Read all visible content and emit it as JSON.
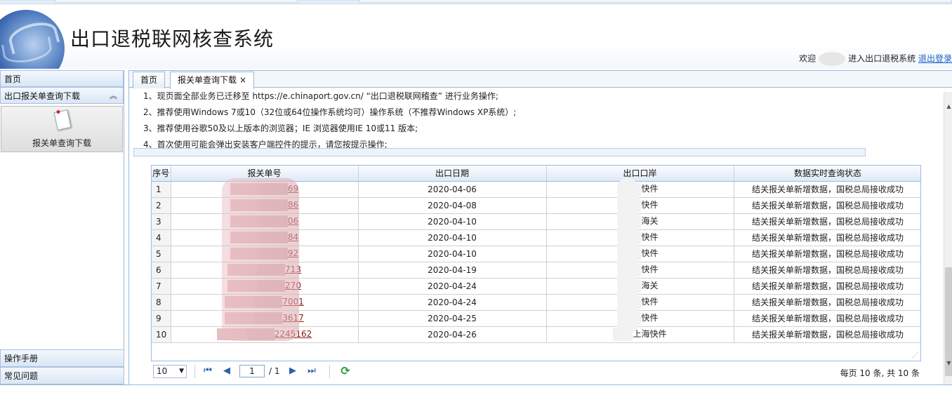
{
  "app": {
    "title": "出口退税联网核查系统",
    "welcome_prefix": "欢迎",
    "welcome_suffix": "进入出口退税系统",
    "logout": "退出登录"
  },
  "sidebar": {
    "sections": [
      {
        "label": "首页"
      },
      {
        "label": "出口报关单查询下载",
        "collapse_icon": "double-chevron-up-icon"
      }
    ],
    "item": {
      "label": "报关单查询下载",
      "icon": "document-icon"
    },
    "bottom_sections": [
      {
        "label": "操作手册"
      },
      {
        "label": "常见问题"
      }
    ]
  },
  "tabs": [
    {
      "label": "首页",
      "active": false
    },
    {
      "label": "报关单查询下载",
      "active": true,
      "close": "×"
    }
  ],
  "notices": [
    "1、现页面全部业务已迁移至 https://e.chinaport.gov.cn/ “出口退税联网稽查” 进行业务操作;",
    "2、推荐使用Windows 7或10（32位或64位操作系统均可）操作系统（不推荐Windows XP系统）;",
    "3、推荐使用谷歌50及以上版本的浏览器；IE 浏览器使用IE 10或11 版本;",
    "4、首次使用可能会弹出安装客户端控件的提示，请您按提示操作;"
  ],
  "grid": {
    "columns": [
      "序号",
      "报关单号",
      "出口日期",
      "出口口岸",
      "数据实时查询状态"
    ],
    "rows": [
      {
        "no": "1",
        "id_tail": "69",
        "date": "2020-04-06",
        "port": "快件",
        "status": "结关报关单新增数据，国税总局接收成功"
      },
      {
        "no": "2",
        "id_tail": "86",
        "date": "2020-04-08",
        "port": "快件",
        "status": "结关报关单新增数据，国税总局接收成功"
      },
      {
        "no": "3",
        "id_tail": "06",
        "date": "2020-04-10",
        "port": "海关",
        "status": "结关报关单新增数据，国税总局接收成功"
      },
      {
        "no": "4",
        "id_tail": "84",
        "date": "2020-04-10",
        "port": "快件",
        "status": "结关报关单新增数据，国税总局接收成功"
      },
      {
        "no": "5",
        "id_tail": "92",
        "date": "2020-04-10",
        "port": "快件",
        "status": "结关报关单新增数据，国税总局接收成功"
      },
      {
        "no": "6",
        "id_tail": "713",
        "date": "2020-04-19",
        "port": "快件",
        "status": "结关报关单新增数据，国税总局接收成功"
      },
      {
        "no": "7",
        "id_tail": "270",
        "date": "2020-04-24",
        "port": "海关",
        "status": "结关报关单新增数据，国税总局接收成功"
      },
      {
        "no": "8",
        "id_tail": "7001",
        "date": "2020-04-24",
        "port": "快件",
        "status": "结关报关单新增数据，国税总局接收成功"
      },
      {
        "no": "9",
        "id_tail": "3617",
        "date": "2020-04-25",
        "port": "快件",
        "status": "结关报关单新增数据，国税总局接收成功"
      },
      {
        "no": "10",
        "id_head": "22",
        "id_tail": "45162",
        "date": "2020-04-26",
        "port": "上海快件",
        "status": "结关报关单新增数据，国税总局接收成功"
      }
    ]
  },
  "pager": {
    "page_size": "10",
    "current_page": "1",
    "total_pages": "/ 1",
    "summary": "每页 10 条, 共 10 条"
  },
  "colors": {
    "link": "#8b1a1a",
    "header_blue": "#2b4f93",
    "border": "#99bbe8"
  }
}
